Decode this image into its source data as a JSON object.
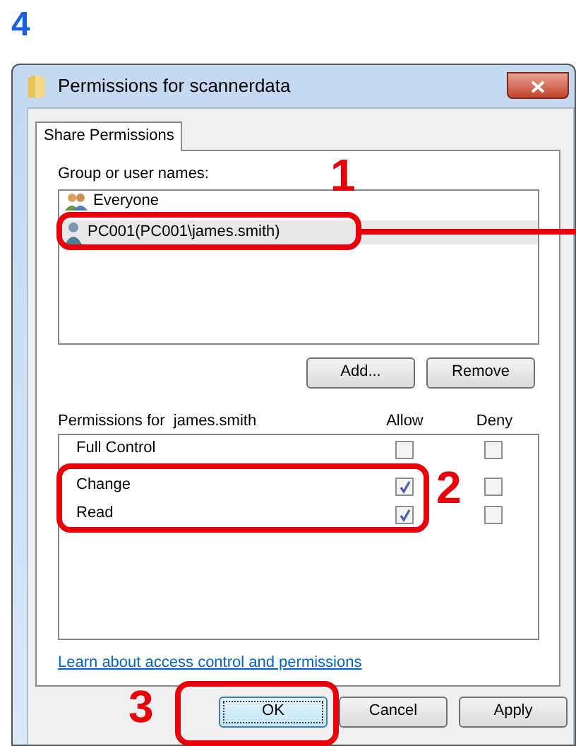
{
  "step": "4",
  "window": {
    "title": "Permissions for scannerdata"
  },
  "tabs": [
    {
      "label": "Share Permissions",
      "selected": true
    }
  ],
  "group_label": "Group or user names:",
  "users": [
    {
      "name": "Everyone",
      "kind": "group",
      "selected": false
    },
    {
      "name": "PC001(PC001\\james.smith)",
      "kind": "user",
      "selected": true
    }
  ],
  "user_buttons": [
    "Add...",
    "Remove"
  ],
  "permissions": {
    "label": "Permissions for  james.smith",
    "columns": [
      "Allow",
      "Deny"
    ],
    "rows": [
      {
        "name": "Full Control",
        "allow": false,
        "deny": false
      },
      {
        "name": "Change",
        "allow": true,
        "deny": false
      },
      {
        "name": "Read",
        "allow": true,
        "deny": false
      }
    ]
  },
  "link": "Learn about access control and permissions",
  "buttons": [
    {
      "label": "OK",
      "default": true
    },
    {
      "label": "Cancel",
      "default": false
    },
    {
      "label": "Apply",
      "default": false
    }
  ],
  "callouts": [
    "1",
    "2",
    "3"
  ]
}
